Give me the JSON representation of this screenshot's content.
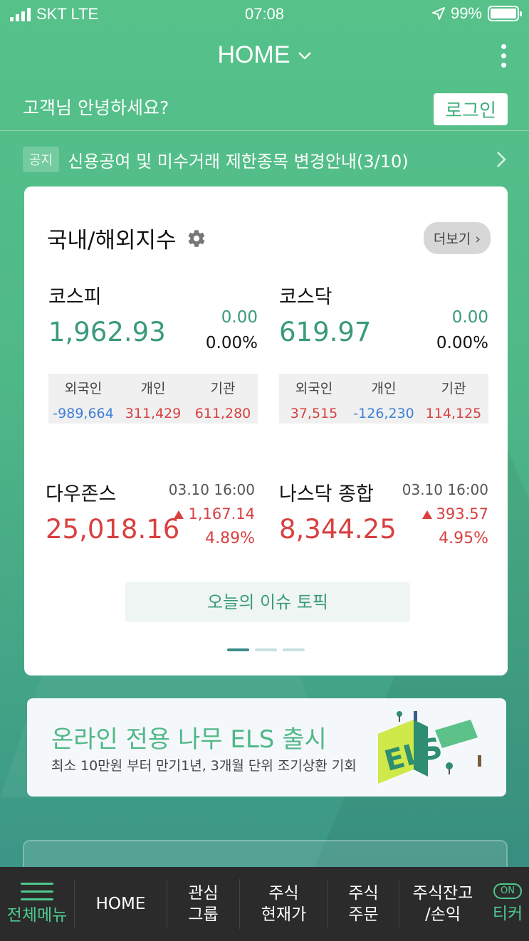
{
  "status": {
    "carrier": "SKT LTE",
    "time": "07:08",
    "battery": "99%"
  },
  "header": {
    "title": "HOME"
  },
  "greeting": "고객님 안녕하세요?",
  "login_label": "로그인",
  "notice": {
    "tag": "공지",
    "text": "신용공여 및 미수거래 제한종목 변경안내(3/10)"
  },
  "card": {
    "title": "국내/해외지수",
    "more_label": "더보기",
    "domestic": [
      {
        "name": "코스피",
        "value": "1,962.93",
        "change": "0.00",
        "rate": "0.00%",
        "flow_headers": [
          "외국인",
          "개인",
          "기관"
        ],
        "flow_values": [
          "-989,664",
          "311,429",
          "611,280"
        ]
      },
      {
        "name": "코스닥",
        "value": "619.97",
        "change": "0.00",
        "rate": "0.00%",
        "flow_headers": [
          "외국인",
          "개인",
          "기관"
        ],
        "flow_values": [
          "37,515",
          "-126,230",
          "114,125"
        ]
      }
    ],
    "global": [
      {
        "name": "다우존스",
        "time": "03.10 16:00",
        "value": "25,018.16",
        "change": "1,167.14",
        "rate": "4.89%"
      },
      {
        "name": "나스닥 종합",
        "time": "03.10 16:00",
        "value": "8,344.25",
        "change": "393.57",
        "rate": "4.95%"
      }
    ],
    "topic_label": "오늘의 이슈 토픽"
  },
  "banner": {
    "title": "온라인 전용 나무 ELS 출시",
    "subtitle": "최소 10만원 부터 만기1년, 3개월 단위 조기상환 기회",
    "art_text": "ELS"
  },
  "nav": {
    "menu_label": "전체메뉴",
    "items": [
      {
        "line1": "HOME",
        "line2": ""
      },
      {
        "line1": "관심",
        "line2": "그룹"
      },
      {
        "line1": "주식",
        "line2": "현재가"
      },
      {
        "line1": "주식",
        "line2": "주문"
      },
      {
        "line1": "주식잔고",
        "line2": "/손익"
      }
    ],
    "ticker_badge": "ON",
    "ticker_label": "티커"
  }
}
